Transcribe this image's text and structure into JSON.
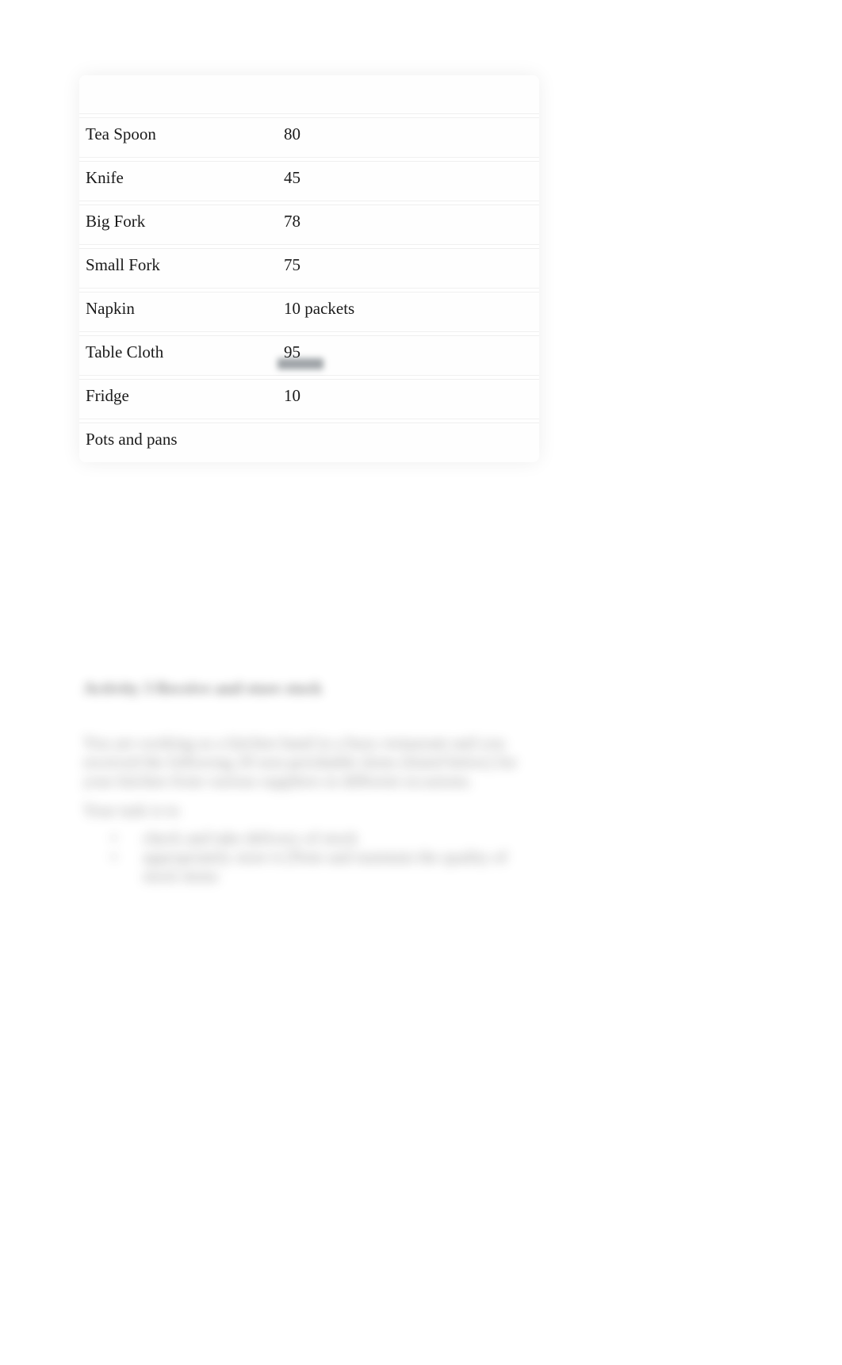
{
  "table": {
    "rows": [
      {
        "item": "Tea Spoon",
        "qty": "80"
      },
      {
        "item": "Knife",
        "qty": "45"
      },
      {
        "item": "Big Fork",
        "qty": "78"
      },
      {
        "item": "Small Fork",
        "qty": "75"
      },
      {
        "item": "Napkin",
        "qty": "10 packets"
      },
      {
        "item": "Table Cloth",
        "qty": "95"
      },
      {
        "item": "Fridge",
        "qty": "10"
      },
      {
        "item": "Pots and pans",
        "qty": ""
      }
    ]
  },
  "activity": {
    "heading": "Activity 3 Receive and store stock",
    "paragraph": "You are working as a kitchen hand in a busy restaurant and you received the following 20 non-perishable items (listed below) for your kitchen from various suppliers in different occasions.",
    "task_label": "Your task is to",
    "bullets": [
      "check and take delivery of stock",
      "appropriately store it (Note and maintain the quality of stock items"
    ]
  }
}
